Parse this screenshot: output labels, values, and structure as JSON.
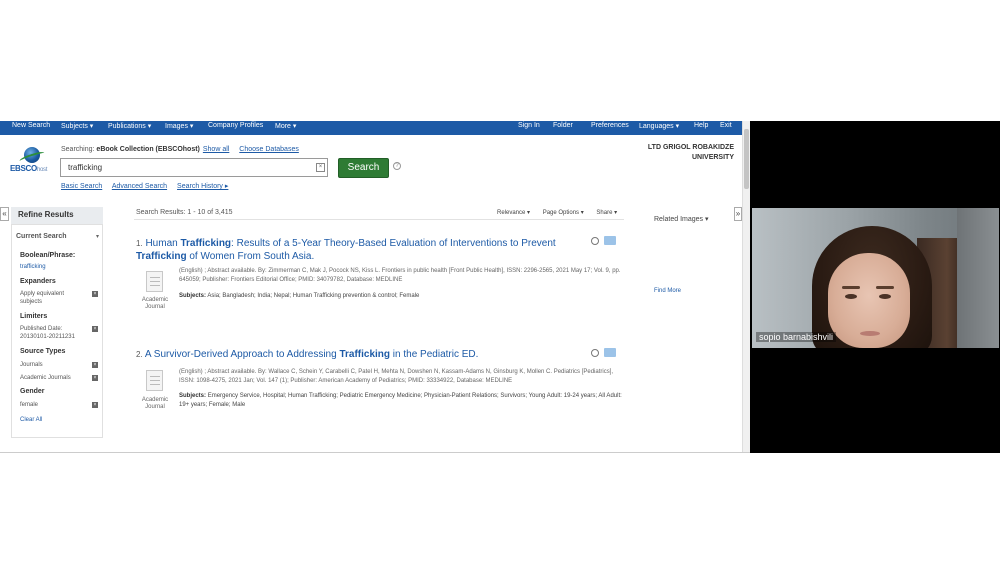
{
  "nav": {
    "items": [
      "New Search",
      "Subjects ▾",
      "Publications ▾",
      "Images ▾",
      "Company Profiles",
      "More ▾"
    ],
    "right_items": [
      "Sign In",
      "Folder",
      "Preferences",
      "Languages ▾",
      "Help",
      "Exit"
    ]
  },
  "header": {
    "logo_main": "EBSCO",
    "logo_sub": "host",
    "searching_label": "Searching:",
    "searching_db": "eBook Collection (EBSCOhost)",
    "show_all": "Show all",
    "choose_db": "Choose Databases",
    "search_value": "trafficking",
    "search_button": "Search",
    "help_glyph": "?",
    "clear_glyph": "×",
    "links": [
      "Basic Search",
      "Advanced Search",
      "Search History ▸"
    ],
    "institution": "LTD GRIGOL ROBAKIDZE UNIVERSITY"
  },
  "sidebar": {
    "collapse_left": "«",
    "collapse_right": "»",
    "title": "Refine Results",
    "current_search": "Current Search",
    "toggle": "▾",
    "remove_glyph": "×",
    "boolean_heading": "Boolean/Phrase:",
    "boolean_value": "trafficking",
    "expanders_heading": "Expanders",
    "expander_value": "Apply equivalent subjects",
    "limiters_heading": "Limiters",
    "limiter_value": "Published Date: 20130101-20211231",
    "source_heading": "Source Types",
    "sources": [
      "Journals",
      "Academic Journals"
    ],
    "gender_heading": "Gender",
    "gender_value": "female",
    "clear_all": "Clear All"
  },
  "results": {
    "count": "Search Results: 1 - 10 of 3,415",
    "tools": [
      "Relevance ▾",
      "Page Options ▾",
      "Share ▾"
    ],
    "doc_type": "Academic Journal",
    "subjects_label": "Subjects:",
    "records": [
      {
        "num": "1.",
        "t1": "Human ",
        "t2": "Trafficking",
        "t3": ": Results of a 5-Year Theory-Based Evaluation of Interventions to Prevent ",
        "t4": "Trafficking",
        "t5": " of Women From South Asia.",
        "meta": "(English) ; Abstract available. By: Zimmerman C, Mak J, Pocock NS, Kiss L. Frontiers in public health [Front Public Health], ISSN: 2296-2565, 2021 May 17; Vol. 9, pp. 645059; Publisher: Frontiers Editorial Office; PMID: 34079782, Database: MEDLINE",
        "subjects": "Asia; Bangladesh; India; Nepal; Human Trafficking prevention & control; Female"
      },
      {
        "num": "2.",
        "t1": "A Survivor-Derived Approach to Addressing ",
        "t2": "Trafficking",
        "t3": " in the Pediatric ED.",
        "meta": "(English) ; Abstract available. By: Wallace C, Schein Y, Carabelli C, Patel H, Mehta N, Dowshen N, Kassam-Adams N, Ginsburg K, Mollen C. Pediatrics [Pediatrics], ISSN: 1098-4275, 2021 Jan; Vol. 147 (1); Publisher: American Academy of Pediatrics; PMID: 33334922, Database: MEDLINE",
        "subjects": "Emergency Service, Hospital; Human Trafficking; Pediatric Emergency Medicine; Physician-Patient Relations; Survivors; Young Adult: 19-24 years; All Adult: 19+ years; Female; Male"
      }
    ]
  },
  "related": {
    "title": "Related Images ▾",
    "find_more": "Find More"
  },
  "video": {
    "participant_name": "sopio barnabishvili"
  }
}
